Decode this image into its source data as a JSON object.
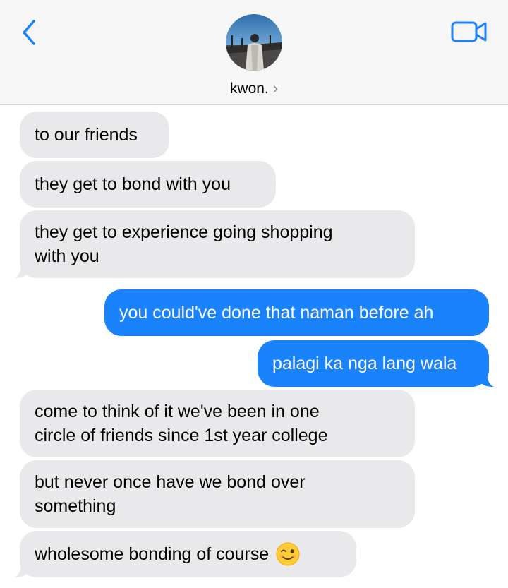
{
  "header": {
    "contact_name": "kwon.",
    "chevron": "›",
    "back_icon": "chevron-left-icon",
    "video_icon": "video-camera-icon"
  },
  "colors": {
    "incoming_bubble": "#e9e9eb",
    "outgoing_bubble": "#1a82fb",
    "accent": "#1a82fb"
  },
  "messages": [
    {
      "direction": "incoming",
      "lines": [
        "to our friends"
      ]
    },
    {
      "direction": "incoming",
      "lines": [
        "they get to bond with you"
      ]
    },
    {
      "direction": "incoming",
      "lines": [
        "they get to experience going shopping",
        "with you"
      ]
    },
    {
      "direction": "outgoing",
      "lines": [
        "you could've done that naman before ah"
      ]
    },
    {
      "direction": "outgoing",
      "lines": [
        "palagi ka nga lang wala"
      ]
    },
    {
      "direction": "incoming",
      "lines": [
        "come to think of it we've been in one",
        "circle of friends since 1st year college"
      ]
    },
    {
      "direction": "incoming",
      "lines": [
        "but never once have we bond over",
        "something"
      ]
    },
    {
      "direction": "incoming",
      "lines": [
        "wholesome bonding of course"
      ],
      "emoji": "winking-face-emoji"
    }
  ]
}
